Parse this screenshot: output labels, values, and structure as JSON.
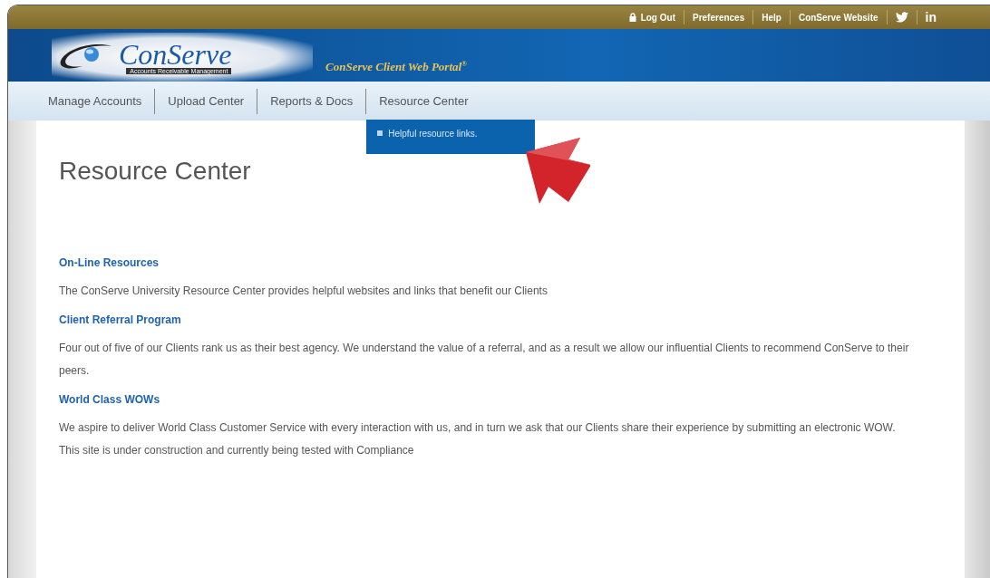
{
  "top_bar": {
    "links": [
      {
        "label": "Log Out",
        "kind": "lock"
      },
      {
        "label": "Preferences",
        "kind": "text"
      },
      {
        "label": "Help",
        "kind": "text"
      },
      {
        "label": "ConServe Website",
        "kind": "text"
      },
      {
        "kind": "twitter"
      },
      {
        "label": "in",
        "kind": "text"
      }
    ]
  },
  "header": {
    "logo_name": "ConServe",
    "logo_tagline": "Accounts Receivable Management",
    "portal_title": "ConServe Client Web Portal$^{®}$"
  },
  "nav": {
    "items": [
      {
        "label": "Manage Accounts"
      },
      {
        "label": "Upload Center"
      },
      {
        "label": "Reports & Docs"
      },
      {
        "label": "Resource Center",
        "open": true,
        "menu": [
          "Helpful resource links."
        ]
      }
    ]
  },
  "page": {
    "title": "Resource Center",
    "sections": [
      {
        "heading": "On-Line Resources",
        "text": "The ConServe University Resource Center provides helpful websites and links that benefit our Clients"
      },
      {
        "heading": "Client Referral Program",
        "text": "Four out of five of our Clients rank us as their best agency. We understand the value of a referral, and as a result we allow our influential Clients to recommend ConServe to their peers."
      },
      {
        "heading": "World Class WOWs",
        "text": "We aspire to deliver World Class Customer Service with every interaction with us, and in turn we ask that our Clients share their experience by submitting an electronic WOW. This site is under construction and currently being tested with Compliance"
      }
    ]
  }
}
